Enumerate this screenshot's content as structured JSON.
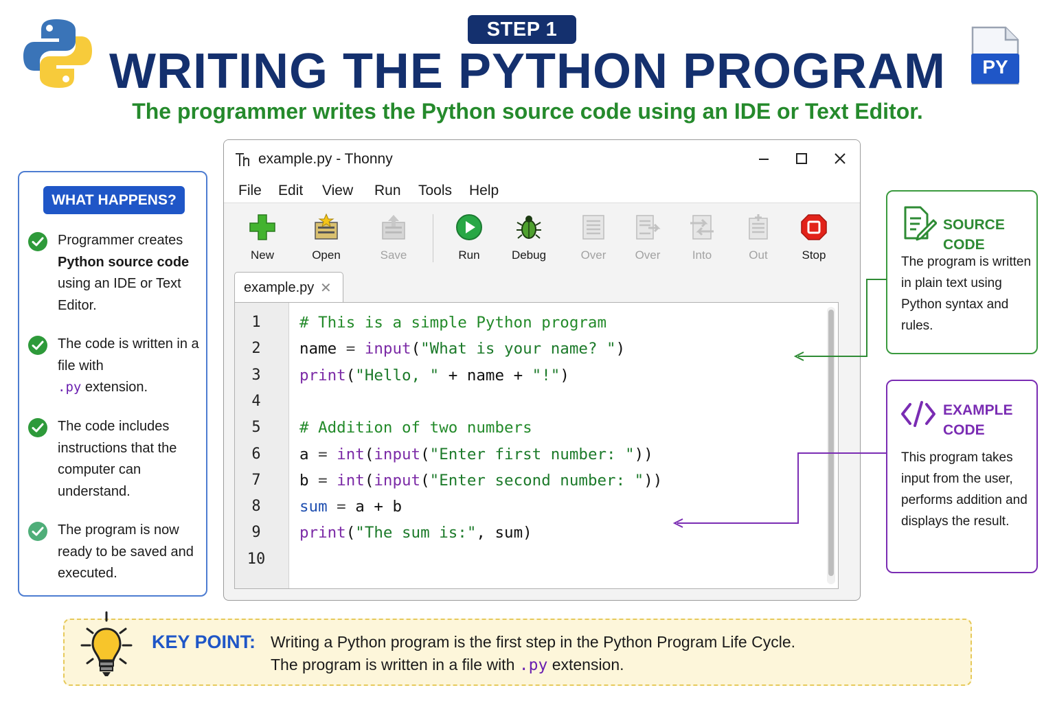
{
  "header": {
    "step_badge": "STEP 1",
    "title": "WRITING THE PYTHON PROGRAM",
    "subtitle": "The programmer writes the Python source code using an IDE or Text Editor.",
    "file_badge": "PY"
  },
  "what_happens": {
    "badge": "WHAT HAPPENS?",
    "items": [
      {
        "pre": "Programmer creates",
        "bold": "Python source code",
        "post": "using an IDE or Text Editor."
      },
      {
        "pre": "The code is written in a file with",
        "mono": ".py",
        "post": "extension."
      },
      {
        "text": "The code includes instructions that the computer can understand."
      },
      {
        "text": "The program is now ready to be saved and executed."
      }
    ]
  },
  "ide": {
    "window_title": "example.py - Thonny",
    "menu": [
      "File",
      "Edit",
      "View",
      "Run",
      "Tools",
      "Help"
    ],
    "toolbar": [
      {
        "label": "New",
        "icon": "new-file-icon",
        "enabled": true
      },
      {
        "label": "Open",
        "icon": "open-folder-icon",
        "enabled": true
      },
      {
        "label": "Save",
        "icon": "save-icon",
        "enabled": false
      },
      {
        "label": "Run",
        "icon": "run-icon",
        "enabled": true
      },
      {
        "label": "Debug",
        "icon": "debug-bug-icon",
        "enabled": true
      },
      {
        "label": "Over",
        "icon": "step-over-icon",
        "enabled": false
      },
      {
        "label": "Over",
        "icon": "step-over-2-icon",
        "enabled": false
      },
      {
        "label": "Into",
        "icon": "step-into-icon",
        "enabled": false
      },
      {
        "label": "Out",
        "icon": "step-out-icon",
        "enabled": false
      },
      {
        "label": "Stop",
        "icon": "stop-icon",
        "enabled": true
      }
    ],
    "tab": {
      "label": "example.py",
      "close": "✕"
    },
    "line_numbers": [
      "1",
      "2",
      "3",
      "4",
      "5",
      "6",
      "7",
      "8",
      "9",
      "10"
    ],
    "code": [
      [
        {
          "t": "# This is a simple Python program",
          "c": "com"
        }
      ],
      [
        {
          "t": "name",
          "c": "plain"
        },
        {
          "t": " = ",
          "c": "op"
        },
        {
          "t": "input",
          "c": "fn"
        },
        {
          "t": "(",
          "c": "plain"
        },
        {
          "t": "\"What is your name? \"",
          "c": "str"
        },
        {
          "t": ")",
          "c": "plain"
        }
      ],
      [
        {
          "t": "print",
          "c": "fn"
        },
        {
          "t": "(",
          "c": "plain"
        },
        {
          "t": "\"Hello, \"",
          "c": "str"
        },
        {
          "t": " + name + ",
          "c": "plain"
        },
        {
          "t": "\"!\"",
          "c": "str"
        },
        {
          "t": ")",
          "c": "plain"
        }
      ],
      [],
      [
        {
          "t": "# Addition of two numbers",
          "c": "com"
        }
      ],
      [
        {
          "t": "a",
          "c": "plain"
        },
        {
          "t": " = ",
          "c": "op"
        },
        {
          "t": "int",
          "c": "fn"
        },
        {
          "t": "(",
          "c": "plain"
        },
        {
          "t": "input",
          "c": "fn"
        },
        {
          "t": "(",
          "c": "plain"
        },
        {
          "t": "\"Enter first number: \"",
          "c": "str"
        },
        {
          "t": "))",
          "c": "plain"
        }
      ],
      [
        {
          "t": "b",
          "c": "plain"
        },
        {
          "t": " = ",
          "c": "op"
        },
        {
          "t": "int",
          "c": "fn"
        },
        {
          "t": "(",
          "c": "plain"
        },
        {
          "t": "input",
          "c": "fn"
        },
        {
          "t": "(",
          "c": "plain"
        },
        {
          "t": "\"Enter second number: \"",
          "c": "str"
        },
        {
          "t": "))",
          "c": "plain"
        }
      ],
      [
        {
          "t": "sum",
          "c": "var"
        },
        {
          "t": " = ",
          "c": "op"
        },
        {
          "t": "a + b",
          "c": "plain"
        }
      ],
      [
        {
          "t": "print",
          "c": "fn"
        },
        {
          "t": "(",
          "c": "plain"
        },
        {
          "t": "\"The sum is:\"",
          "c": "str"
        },
        {
          "t": ", sum)",
          "c": "plain"
        }
      ],
      []
    ]
  },
  "source_code_callout": {
    "title": "SOURCE CODE",
    "body": "The program is written in plain text using Python syntax and rules."
  },
  "example_code_callout": {
    "title_line1": "EXAMPLE",
    "title_line2": "CODE",
    "body": "This program takes input from the user, performs addition and displays the result."
  },
  "key_point": {
    "label": "KEY POINT:",
    "line1": "Writing a Python program is the first step in the Python Program Life Cycle.",
    "line2_pre": "The program is written in a file with",
    "line2_mono": ".py",
    "line2_post": "extension."
  },
  "colors": {
    "navy": "#14306e",
    "green": "#258a2c",
    "blue": "#1f56c7",
    "purple": "#7a2cb3"
  }
}
